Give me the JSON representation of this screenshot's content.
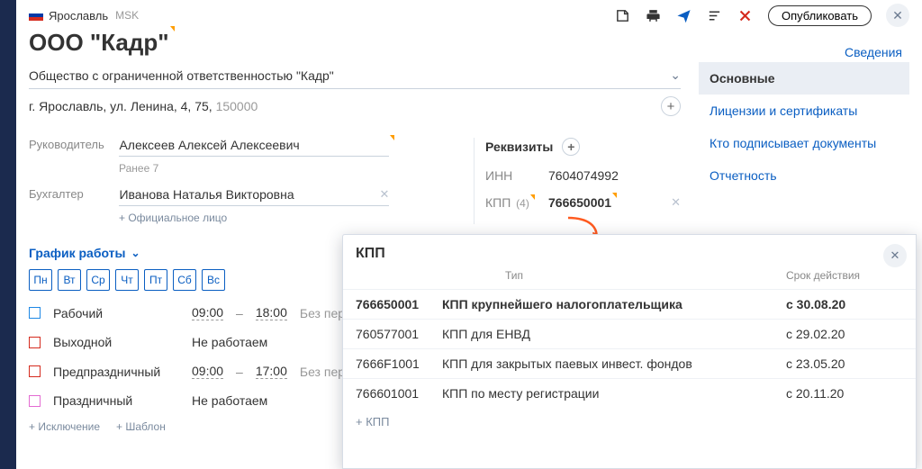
{
  "header": {
    "location": "Ярославль",
    "timezone": "MSK",
    "publish": "Опубликовать",
    "info_link": "Сведения"
  },
  "title": "ООО \"Кадр\"",
  "fullname": "Общество с ограниченной ответственностью \"Кадр\"",
  "address_text": "г. Ярославль, ул. Ленина, 4, 75, ",
  "address_postal": "150000",
  "people": {
    "director_label": "Руководитель",
    "director_name": "Алексеев Алексей Алексеевич",
    "previous_hint": "Ранее 7",
    "accountant_label": "Бухгалтер",
    "accountant_name": "Иванова Наталья Викторовна",
    "add_official": "+ Официальное лицо"
  },
  "requisites": {
    "title": "Реквизиты",
    "inn_label": "ИНН",
    "inn_value": "7604074992",
    "kpp_label": "КПП",
    "kpp_count": "(4)",
    "kpp_value": "766650001"
  },
  "sidenav": {
    "items": [
      {
        "label": "Основные",
        "active": true
      },
      {
        "label": "Лицензии и сертификаты",
        "active": false
      },
      {
        "label": "Кто подписывает документы",
        "active": false
      },
      {
        "label": "Отчетность",
        "active": false
      }
    ]
  },
  "schedule": {
    "title": "График работы",
    "days": [
      "Пн",
      "Вт",
      "Ср",
      "Чт",
      "Пт",
      "Сб",
      "Вс"
    ],
    "rows": [
      {
        "name": "Рабочий",
        "color": "blue",
        "from": "09:00",
        "to": "18:00",
        "hint": "Без пер"
      },
      {
        "name": "Выходной",
        "color": "red",
        "text": "Не работаем"
      },
      {
        "name": "Предпраздничный",
        "color": "red",
        "from": "09:00",
        "to": "17:00",
        "hint": "Без пер"
      },
      {
        "name": "Праздничный",
        "color": "pink",
        "text": "Не работаем"
      }
    ],
    "add_exception": "+ Исключение",
    "add_template": "+ Шаблон"
  },
  "kpp_popup": {
    "title": "КПП",
    "col_type": "Тип",
    "col_since": "Срок действия",
    "rows": [
      {
        "code": "766650001",
        "type": "КПП крупнейшего налогоплательщика",
        "since": "с 30.08.20",
        "bold": true
      },
      {
        "code": "760577001",
        "type": "КПП для ЕНВД",
        "since": "с 29.02.20"
      },
      {
        "code": "7666F1001",
        "type": "КПП для закрытых паевых инвест. фондов",
        "since": "с 23.05.20"
      },
      {
        "code": "766601001",
        "type": "КПП по месту регистрации",
        "since": "с 20.11.20"
      }
    ],
    "add": "+ КПП"
  }
}
